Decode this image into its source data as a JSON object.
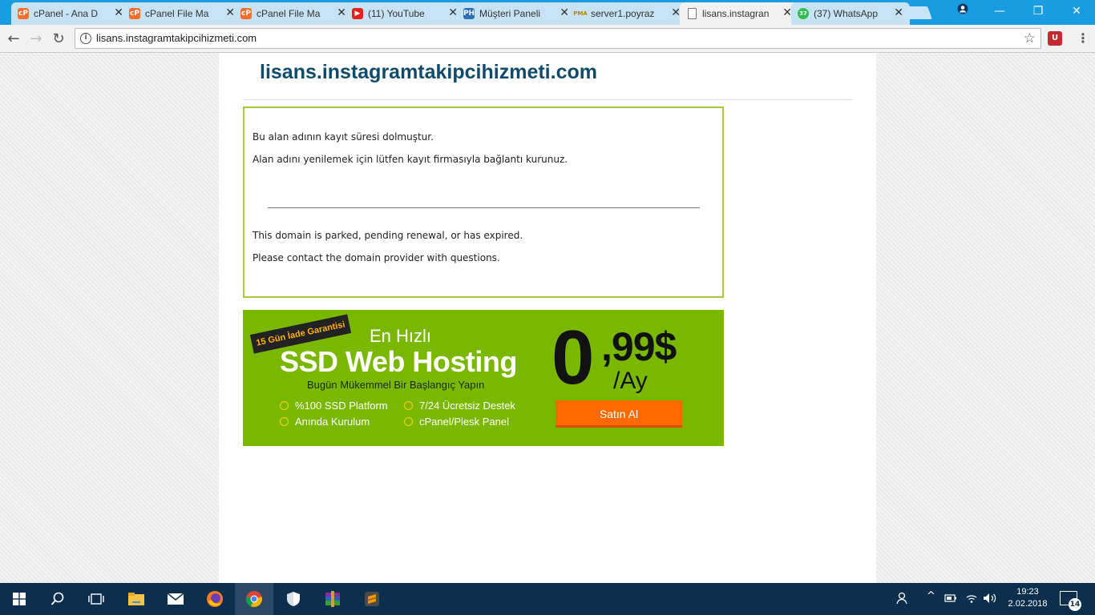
{
  "browser": {
    "tabs": [
      {
        "title": "cPanel - Ana D",
        "icon": "cpanel-icon",
        "active": false
      },
      {
        "title": "cPanel File Ma",
        "icon": "cpanel-icon",
        "active": false
      },
      {
        "title": "cPanel File Ma",
        "icon": "cpanel-icon",
        "active": false
      },
      {
        "title": "(11) YouTube",
        "icon": "youtube-icon",
        "active": false
      },
      {
        "title": "Müşteri Paneli",
        "icon": "ph-icon",
        "active": false
      },
      {
        "title": "server1.poyraz",
        "icon": "phpmyadmin-icon",
        "active": false
      },
      {
        "title": "lisans.instagran",
        "icon": "document-icon",
        "active": true
      },
      {
        "title": "(37) WhatsApp",
        "icon": "whatsapp-icon",
        "active": false
      }
    ],
    "tab_icons_text": {
      "cpanel": "cP",
      "youtube": "▶",
      "ph": "PH",
      "pma": "PMA",
      "doc": "",
      "wa": "37"
    },
    "address": "lisans.instagramtakipcihizmeti.com",
    "extension_label": "U"
  },
  "page": {
    "domain_heading": "lisans.instagramtakipcihizmeti.com",
    "notice_tr_line1": "Bu alan adının kayıt süresi dolmuştur.",
    "notice_tr_line2": "Alan adını yenilemek için lütfen kayıt firmasıyla bağlantı kurunuz.",
    "notice_en_line1": "This domain is parked, pending renewal, or has expired.",
    "notice_en_line2": "Please contact the domain provider with questions."
  },
  "banner": {
    "ribbon": "15 Gün İade Garantisi",
    "tagline": "En Hızlı",
    "headline": "SSD Web Hosting",
    "subline": "Bugün Mükemmel Bir Başlangıç Yapın",
    "features": [
      "%100 SSD Platform",
      "7/24 Ücretsiz Destek",
      "Anında Kurulum",
      "cPanel/Plesk Panel"
    ],
    "price_whole": "0",
    "price_cents": ",99$",
    "price_period": "/Ay",
    "cta": "Satın Al",
    "colors": {
      "background": "#7ab800",
      "cta": "#ff6a00"
    }
  },
  "taskbar": {
    "time": "19:23",
    "date": "2.02.2018",
    "notifications": "14"
  }
}
